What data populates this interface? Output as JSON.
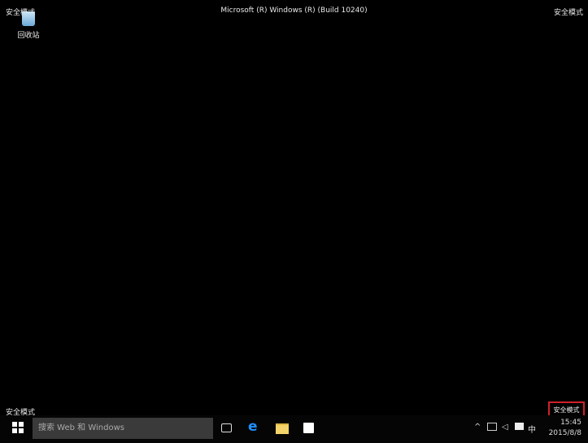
{
  "title": "Microsoft (R) Windows (R) (Build 10240)",
  "watermark": "安全模式",
  "desktop": {
    "recycle_bin": "回收站"
  },
  "taskbar": {
    "search_placeholder": "搜索 Web 和 Windows",
    "ime": "中",
    "time": "15:45",
    "date": "2015/8/8"
  }
}
